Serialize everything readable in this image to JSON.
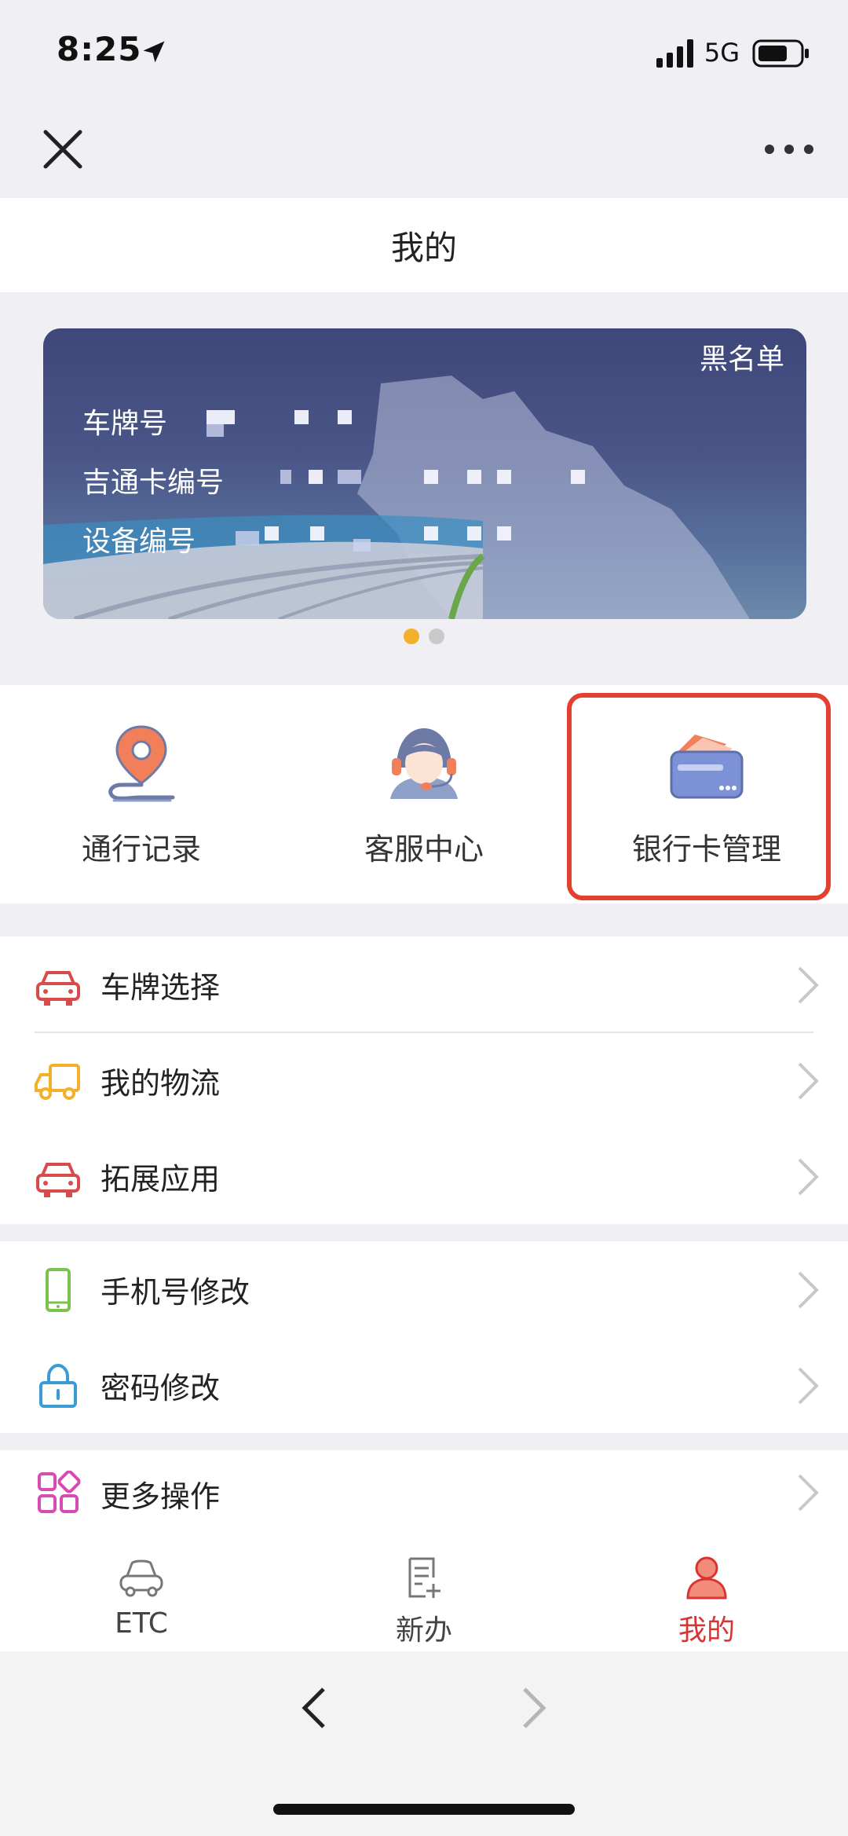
{
  "status_bar": {
    "time": "8:25",
    "network": "5G"
  },
  "page": {
    "title": "我的"
  },
  "card": {
    "badge": "黑名单",
    "rows": [
      {
        "label": "车牌号"
      },
      {
        "label": "吉通卡编号"
      },
      {
        "label": "设备编号"
      }
    ],
    "pagination": {
      "total": 2,
      "active": 1
    }
  },
  "quick_actions": [
    {
      "label": "通行记录",
      "icon": "location-route-icon"
    },
    {
      "label": "客服中心",
      "icon": "customer-service-icon"
    },
    {
      "label": "银行卡管理",
      "icon": "bank-card-icon",
      "highlighted": true
    }
  ],
  "menu": {
    "group1": [
      {
        "label": "车牌选择",
        "icon": "car-icon",
        "color": "#d84b4b"
      },
      {
        "label": "我的物流",
        "icon": "truck-icon",
        "color": "#f2b12b"
      },
      {
        "label": "拓展应用",
        "icon": "car-icon",
        "color": "#d84b4b"
      }
    ],
    "group2": [
      {
        "label": "手机号修改",
        "icon": "phone-icon",
        "color": "#7cc24c"
      },
      {
        "label": "密码修改",
        "icon": "lock-icon",
        "color": "#3a9cd6"
      }
    ],
    "group3": [
      {
        "label": "更多操作",
        "icon": "grid-icon",
        "color": "#d84bb0"
      }
    ]
  },
  "tabbar": [
    {
      "label": "ETC",
      "icon": "car-outline-icon",
      "active": false
    },
    {
      "label": "新办",
      "icon": "document-add-icon",
      "active": false
    },
    {
      "label": "我的",
      "icon": "user-icon",
      "active": true
    }
  ],
  "colors": {
    "accent": "#d93434",
    "highlight_border": "#e3412f",
    "dot_active": "#f2b12b"
  }
}
